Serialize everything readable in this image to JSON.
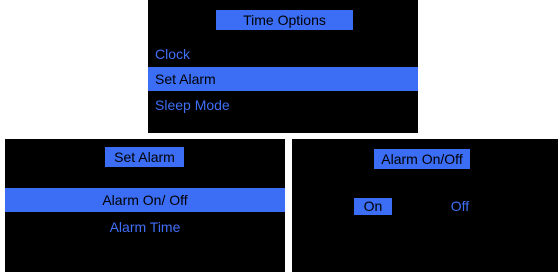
{
  "colors": {
    "background": "#000000",
    "accent": "#3b6df5",
    "text_unselected": "#3f6ff6",
    "text_selected": "#000000"
  },
  "time_options": {
    "title": "Time Options",
    "items": [
      {
        "label": "Clock",
        "selected": false
      },
      {
        "label": "Set Alarm",
        "selected": true
      },
      {
        "label": "Sleep Mode",
        "selected": false
      }
    ]
  },
  "set_alarm": {
    "title": "Set Alarm",
    "items": [
      {
        "label": "Alarm On/ Off",
        "selected": true
      },
      {
        "label": "Alarm Time",
        "selected": false
      }
    ]
  },
  "alarm_onoff": {
    "title": "Alarm On/Off",
    "options": [
      {
        "label": "On",
        "selected": true
      },
      {
        "label": "Off",
        "selected": false
      }
    ]
  }
}
